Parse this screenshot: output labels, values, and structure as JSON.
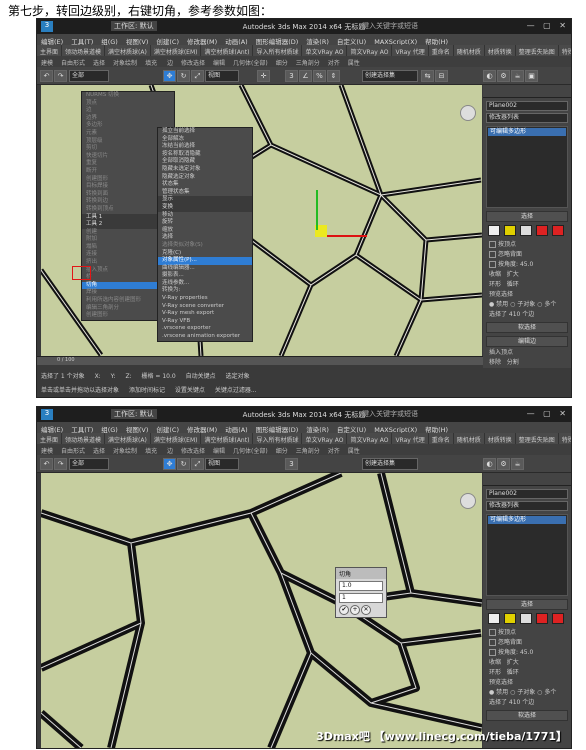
{
  "caption": "第七步，转回边级别，右键切角，参考参数如图：",
  "app": {
    "title": "Autodesk 3ds Max 2014 x64    无标题",
    "workspace": "工作区: 默认",
    "help_search": "键入关键字或短语",
    "logo": "3"
  },
  "menubar": [
    "编辑(E)",
    "工具(T)",
    "组(G)",
    "视图(V)",
    "创建(C)",
    "修改器(M)",
    "动画(A)",
    "图形编辑器(D)",
    "渲染(R)",
    "自定义(U)",
    "MAXScript(X)",
    "帮助(H)"
  ],
  "plugin_bar": [
    "主界面",
    "领动场景道模",
    "满空材质球(A)",
    "满空材质球(EM)",
    "满空材质球(Ant)",
    "导入所有材质球",
    "单文VRay AO",
    "简文VRay AO",
    "VRay 代理",
    "重命名",
    "随机材质",
    "材质转换",
    "整理丢失贴图",
    "特殊功能",
    "超级彩网VRay材质"
  ],
  "ribbon": [
    "建模",
    "自由形式",
    "选择",
    "对象绘制",
    "填充"
  ],
  "ribbon2": [
    "边",
    "修改选择",
    "编辑",
    "几何体(全部)",
    "细分",
    "三角剖分",
    "对齐",
    "属性"
  ],
  "toolbar": {
    "filter": "全部",
    "refcoord": "视图",
    "selection_set": "创建选择集"
  },
  "context_menu": {
    "quad_left": [
      {
        "label": "NURMS 切换",
        "state": "disabled"
      },
      {
        "label": "顶点",
        "state": "disabled"
      },
      {
        "label": "边",
        "state": "disabled"
      },
      {
        "label": "边界",
        "state": "disabled"
      },
      {
        "label": "多边形",
        "state": "disabled"
      },
      {
        "label": "元素",
        "state": "disabled"
      },
      {
        "label": "顶层级",
        "state": "disabled"
      },
      {
        "label": "剪切",
        "state": "disabled"
      },
      {
        "label": "快速切片",
        "state": "disabled"
      },
      {
        "label": "重复",
        "state": "disabled"
      },
      {
        "label": "断开",
        "state": "disabled"
      },
      {
        "label": "创建图形",
        "state": "disabled"
      },
      {
        "label": "目标焊接",
        "state": "disabled"
      },
      {
        "label": "转换到面",
        "state": "disabled"
      },
      {
        "label": "转换到边",
        "state": "disabled"
      },
      {
        "label": "转换到顶点",
        "state": "disabled"
      },
      {
        "label": "工具 1",
        "state": "header"
      },
      {
        "label": "工具 2",
        "state": "header"
      },
      {
        "label": "创建",
        "state": "disabled"
      },
      {
        "label": "附加",
        "state": "disabled"
      },
      {
        "label": "塌陷",
        "state": "disabled"
      },
      {
        "label": "连接",
        "state": "disabled"
      },
      {
        "label": "挤出",
        "state": "disabled"
      },
      {
        "label": "插入顶点",
        "state": "disabled"
      },
      {
        "label": "桥",
        "state": "disabled"
      },
      {
        "label": "切角",
        "state": "highlight"
      },
      {
        "label": "焊接",
        "state": "disabled"
      },
      {
        "label": "利用所选内容创建图形",
        "state": "disabled"
      },
      {
        "label": "编辑三角剖分",
        "state": "disabled"
      },
      {
        "label": "创建图形",
        "state": "disabled"
      }
    ],
    "quad_right": [
      {
        "label": "孤立当前选择",
        "state": "normal"
      },
      {
        "label": "全部解冻",
        "state": "normal"
      },
      {
        "label": "冻结当前选择",
        "state": "normal"
      },
      {
        "label": "按名称取消隐藏",
        "state": "normal"
      },
      {
        "label": "全部取消隐藏",
        "state": "normal"
      },
      {
        "label": "隐藏未选定对象",
        "state": "normal"
      },
      {
        "label": "隐藏选定对象",
        "state": "normal"
      },
      {
        "label": "状态集",
        "state": "normal"
      },
      {
        "label": "管理状态集",
        "state": "normal"
      },
      {
        "label": "显示",
        "state": "header"
      },
      {
        "label": "变换",
        "state": "header"
      },
      {
        "label": "移动",
        "state": "normal"
      },
      {
        "label": "旋转",
        "state": "normal"
      },
      {
        "label": "缩放",
        "state": "normal"
      },
      {
        "label": "选择",
        "state": "normal"
      },
      {
        "label": "选择类似对象(S)",
        "state": "disabled"
      },
      {
        "label": "克隆(C)",
        "state": "normal"
      },
      {
        "label": "对象属性(P)...",
        "state": "highlight"
      },
      {
        "label": "曲线编辑器...",
        "state": "normal"
      },
      {
        "label": "摄影表...",
        "state": "normal"
      },
      {
        "label": "连线参数...",
        "state": "normal"
      },
      {
        "label": "转换为:",
        "state": "normal"
      },
      {
        "label": "V-Ray properties",
        "state": "normal"
      },
      {
        "label": "V-Ray scene converter",
        "state": "normal"
      },
      {
        "label": "V-Ray mesh export",
        "state": "normal"
      },
      {
        "label": "V-Ray VFB",
        "state": "normal"
      },
      {
        "label": ".vrscene exporter",
        "state": "normal"
      },
      {
        "label": ".vrscene animation exporter",
        "state": "normal"
      }
    ]
  },
  "command_panel": {
    "object_name": "Plane002",
    "modifier_list": "修改器列表",
    "stack_item": "可编辑多边形",
    "rollout_selection": "选择",
    "checkbox_by_vertex": "按顶点",
    "checkbox_ignore_backfacing": "忽略背面",
    "checkbox_by_angle": "按角度:",
    "angle_value": "45.0",
    "shrink": "收缩",
    "grow": "扩大",
    "ring": "环形",
    "loop": "循环",
    "preview_selection": "预览选择",
    "preview_off": "禁用",
    "preview_subobj": "子对象",
    "preview_multi": "多个",
    "selected_count": "选择了 410 个边",
    "rollout_soft_sel": "软选择",
    "rollout_edit_edges": "编辑边",
    "insert_vertex": "插入顶点",
    "remove": "移除",
    "split": "分割"
  },
  "statusbar": {
    "selected": "选择了 1 个对象",
    "hint": "单击或单击并拖动以选择对象",
    "x_label": "X:",
    "y_label": "Y:",
    "z_label": "Z:",
    "grid": "栅格 = 10.0",
    "auto_key": "自动关键点",
    "selection": "选定对象",
    "set_key": "设置关键点",
    "key_filter": "关键点过滤器...",
    "add_time_tag": "添加时间标记",
    "frame": "0 / 100",
    "maxscript": "MAXScript"
  },
  "caddy": {
    "title": "切角",
    "amount": "1.0",
    "segments": "1"
  },
  "watermark": "3Dmax吧 【www.linecg.com/tieba/1771】"
}
